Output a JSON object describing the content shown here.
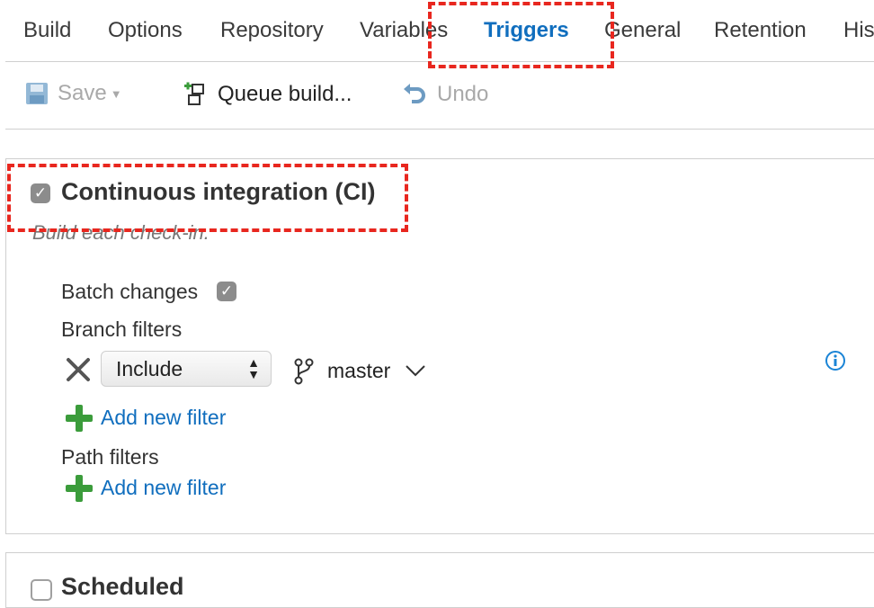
{
  "tabs": [
    "Build",
    "Options",
    "Repository",
    "Variables",
    "Triggers",
    "General",
    "Retention",
    "His"
  ],
  "active_tab": "Triggers",
  "toolbar": {
    "save_label": "Save",
    "queue_label": "Queue build...",
    "undo_label": "Undo"
  },
  "ci": {
    "title": "Continuous integration (CI)",
    "subtitle": "Build each check-in.",
    "batch_label": "Batch changes",
    "batch_checked": true,
    "branch_filters_label": "Branch filters",
    "filter_mode": "Include",
    "branch": "master",
    "add_filter_label": "Add new filter",
    "path_filters_label": "Path filters",
    "add_path_filter_label": "Add new filter"
  },
  "scheduled": {
    "title": "Scheduled"
  },
  "colors": {
    "accent": "#106ebe",
    "highlight": "#e8271f",
    "add_green": "#3b9c3b"
  },
  "icons": [
    "save-icon",
    "queue-build-icon",
    "undo-icon",
    "remove-filter-icon",
    "branch-icon",
    "info-icon",
    "add-icon"
  ]
}
